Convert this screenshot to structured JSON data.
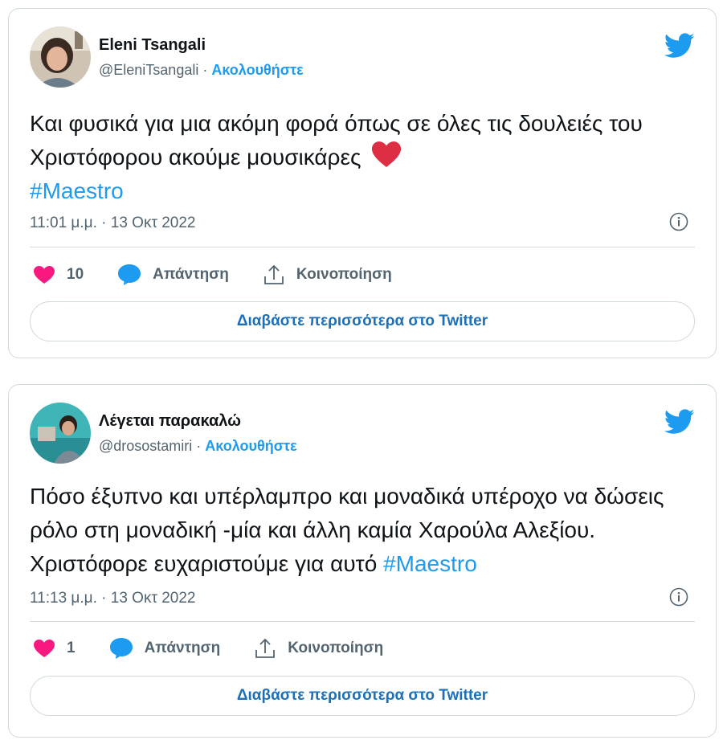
{
  "tweets": [
    {
      "author_name": "Eleni Tsangali",
      "handle": "@EleniTsangali",
      "separator": " · ",
      "follow_label": "Ακολουθήστε",
      "text": "Και φυσικά για μια ακόμη φορά όπως σε όλες τις δουλειές του Χριστόφορου ακούμε μουσικάρες",
      "hashtag": "#Maestro",
      "timestamp": "11:01 μ.μ. · 13 Οκτ 2022",
      "likes": "10",
      "reply_label": "Απάντηση",
      "share_label": "Κοινοποίηση",
      "read_more_label": "Διαβάστε περισσότερα στο Twitter"
    },
    {
      "author_name": "Λέγεται παρακαλώ",
      "handle": "@drosostamiri",
      "separator": " · ",
      "follow_label": "Ακολουθήστε",
      "text": "Πόσο έξυπνο και υπέρλαμπρο και μοναδικά υπέροχο να δώσεις ρόλο στη μοναδική -μία και άλλη καμία Χαρούλα Αλεξίου. Χριστόφορε ευχαριστούμε για αυτό",
      "hashtag": "#Maestro",
      "timestamp": "11:13 μ.μ. · 13 Οκτ 2022",
      "likes": "1",
      "reply_label": "Απάντηση",
      "share_label": "Κοινοποίηση",
      "read_more_label": "Διαβάστε περισσότερα στο Twitter"
    }
  ],
  "icons": {
    "brand": "twitter-bird-icon",
    "like": "heart-icon",
    "reply": "speech-bubble-icon",
    "share": "share-icon",
    "info": "info-icon",
    "emoji": "red-heart-emoji-icon"
  },
  "colors": {
    "twitter_blue": "#1d9bf0",
    "like_pink": "#f91880",
    "emoji_red": "#dd2e44",
    "border": "#cfd9de",
    "muted_text": "#536471"
  }
}
